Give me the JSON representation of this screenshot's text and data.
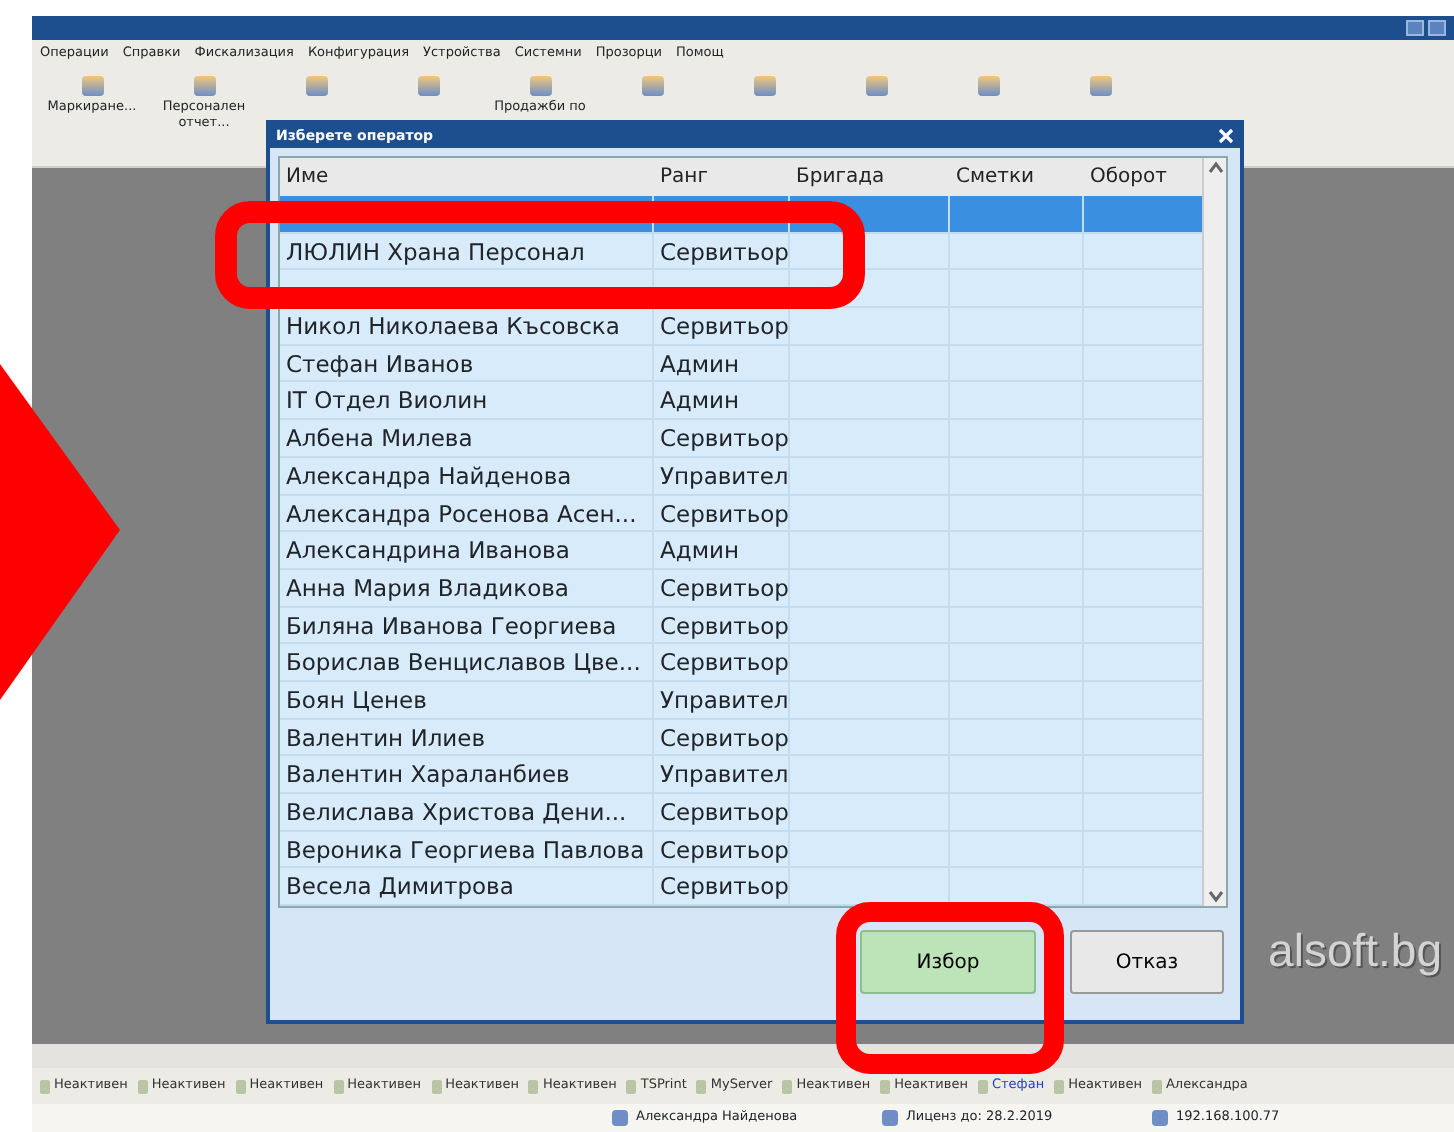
{
  "menu": [
    "Операции",
    "Справки",
    "Фискализация",
    "Конфигурация",
    "Устройства",
    "Системни",
    "Прозорци",
    "Помощ"
  ],
  "toolbar": [
    {
      "kind": "labeled",
      "label": "Маркиране..."
    },
    {
      "kind": "labeled",
      "label": "Персонален отчет..."
    },
    {
      "kind": "icon"
    },
    {
      "kind": "icon"
    },
    {
      "kind": "labeled",
      "label": "Продажби по"
    },
    {
      "kind": "icon"
    },
    {
      "kind": "icon"
    },
    {
      "kind": "icon"
    },
    {
      "kind": "icon"
    },
    {
      "kind": "icon"
    }
  ],
  "background_logo": "alsoft.bg",
  "dialog": {
    "title": "Изберете оператор",
    "columns": [
      "Име",
      "Ранг",
      "Бригада",
      "Сметки",
      "Оборот"
    ],
    "rows": [
      {
        "selected": true
      },
      {
        "name": "ЛЮЛИН Храна Персонал",
        "rank": "Сервитьор",
        "selected": false
      },
      {
        "selected": false
      },
      {
        "name": "Никол Николаева Късовска",
        "rank": "Сервитьор",
        "selected": false
      },
      {
        "name": "Стефан Иванов",
        "rank": "Админ",
        "selected": false
      },
      {
        "name": "IT Отдел Виолин",
        "rank": "Админ",
        "selected": false
      },
      {
        "name": "Албена Милева",
        "rank": "Сервитьор",
        "selected": false
      },
      {
        "name": "Александра Найденова",
        "rank": "Управител",
        "selected": false
      },
      {
        "name": "Александра Росенова Асен...",
        "rank": "Сервитьор",
        "selected": false
      },
      {
        "name": "Александрина Иванова",
        "rank": "Админ",
        "selected": false
      },
      {
        "name": "Анна Мария Владикова",
        "rank": "Сервитьор",
        "selected": false
      },
      {
        "name": "Биляна Иванова Георгиева",
        "rank": "Сервитьор",
        "selected": false
      },
      {
        "name": "Борислав Венциславов Цве...",
        "rank": "Сервитьор",
        "selected": false
      },
      {
        "name": "Боян Ценев",
        "rank": "Управител",
        "selected": false
      },
      {
        "name": "Валентин Илиев",
        "rank": "Сервитьор",
        "selected": false
      },
      {
        "name": "Валентин Хараланбиев",
        "rank": "Управител",
        "selected": false
      },
      {
        "name": "Велислава Христова Дени...",
        "rank": "Сервитьор",
        "selected": false
      },
      {
        "name": "Вероника Георгиева Павлова",
        "rank": "Сервитьор",
        "selected": false
      },
      {
        "name": "Весела Димитрова",
        "rank": "Сервитьор",
        "selected": false
      }
    ],
    "buttons": [
      {
        "label": "Избор",
        "kind": "primary"
      },
      {
        "label": "Отказ",
        "kind": "secondary"
      }
    ]
  },
  "taskbar": [
    {
      "label": "Неактивен",
      "selected": false
    },
    {
      "label": "Неактивен",
      "selected": false
    },
    {
      "label": "Неактивен",
      "selected": false
    },
    {
      "label": "Неактивен",
      "selected": false
    },
    {
      "label": "Неактивен",
      "selected": false
    },
    {
      "label": "Неактивен",
      "selected": false
    },
    {
      "label": "TSPrint",
      "selected": false
    },
    {
      "label": "MyServer",
      "selected": false
    },
    {
      "label": "Неактивен",
      "selected": false
    },
    {
      "label": "Неактивен",
      "selected": false
    },
    {
      "label": "Стефан",
      "selected": true
    },
    {
      "label": "Неактивен",
      "selected": false
    },
    {
      "label": "Александра",
      "selected": false
    }
  ],
  "status_bar": [
    "Александра Найденова",
    "Лиценз до: 28.2.2019",
    "192.168.100.77"
  ]
}
